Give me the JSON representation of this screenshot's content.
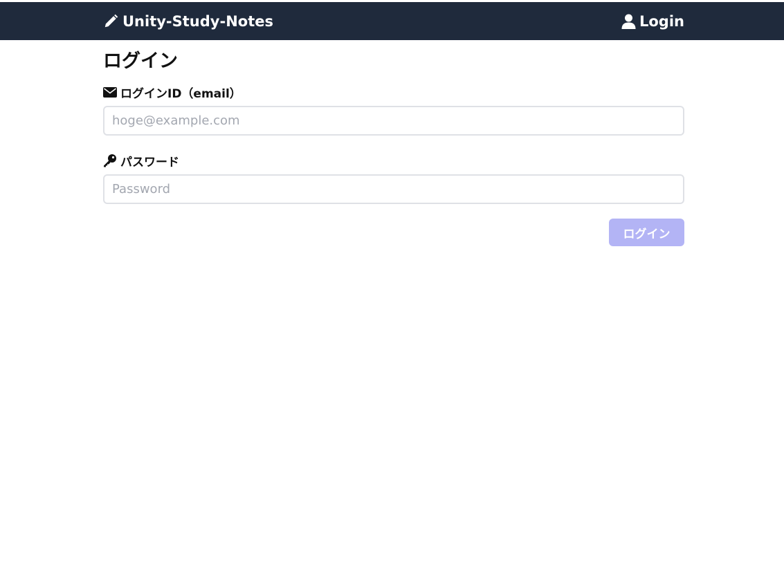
{
  "navbar": {
    "brand_label": "Unity-Study-Notes",
    "brand_icon": "pencil-icon",
    "login_label": "Login",
    "login_icon": "user-icon",
    "background_color": "#1f2a3c"
  },
  "main": {
    "title": "ログイン",
    "email": {
      "label": "ログインID（email）",
      "icon": "envelope-icon",
      "value": "",
      "placeholder": "hoge@example.com"
    },
    "password": {
      "label": "パスワード",
      "icon": "key-icon",
      "value": "",
      "placeholder": "Password"
    },
    "submit_label": "ログイン",
    "submit_color": "#b3b4f5"
  }
}
